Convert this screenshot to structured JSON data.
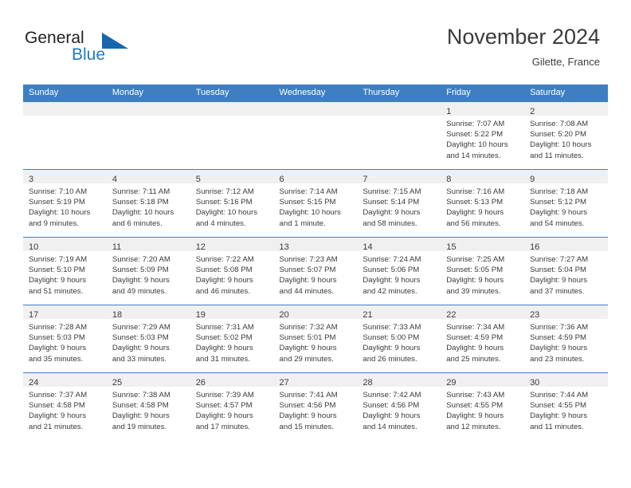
{
  "brand": {
    "name_part1": "General",
    "name_part2": "Blue",
    "logo_icon": "triangle-flag-icon",
    "accent_color": "#1667ad"
  },
  "header": {
    "title": "November 2024",
    "location": "Gilette, France"
  },
  "theme": {
    "header_blue": "#3d7fc1",
    "daynum_band": "#f0f0f0",
    "text": "#3b3b3b"
  },
  "calendar": {
    "weekday_headers": [
      "Sunday",
      "Monday",
      "Tuesday",
      "Wednesday",
      "Thursday",
      "Friday",
      "Saturday"
    ],
    "weeks": [
      [
        {
          "empty": true,
          "day": "",
          "sunrise": "",
          "sunset": "",
          "daylight_line1": "",
          "daylight_line2": ""
        },
        {
          "empty": true,
          "day": "",
          "sunrise": "",
          "sunset": "",
          "daylight_line1": "",
          "daylight_line2": ""
        },
        {
          "empty": true,
          "day": "",
          "sunrise": "",
          "sunset": "",
          "daylight_line1": "",
          "daylight_line2": ""
        },
        {
          "empty": true,
          "day": "",
          "sunrise": "",
          "sunset": "",
          "daylight_line1": "",
          "daylight_line2": ""
        },
        {
          "empty": true,
          "day": "",
          "sunrise": "",
          "sunset": "",
          "daylight_line1": "",
          "daylight_line2": ""
        },
        {
          "empty": false,
          "day": "1",
          "sunrise": "Sunrise: 7:07 AM",
          "sunset": "Sunset: 5:22 PM",
          "daylight_line1": "Daylight: 10 hours",
          "daylight_line2": "and 14 minutes."
        },
        {
          "empty": false,
          "day": "2",
          "sunrise": "Sunrise: 7:08 AM",
          "sunset": "Sunset: 5:20 PM",
          "daylight_line1": "Daylight: 10 hours",
          "daylight_line2": "and 11 minutes."
        }
      ],
      [
        {
          "empty": false,
          "day": "3",
          "sunrise": "Sunrise: 7:10 AM",
          "sunset": "Sunset: 5:19 PM",
          "daylight_line1": "Daylight: 10 hours",
          "daylight_line2": "and 9 minutes."
        },
        {
          "empty": false,
          "day": "4",
          "sunrise": "Sunrise: 7:11 AM",
          "sunset": "Sunset: 5:18 PM",
          "daylight_line1": "Daylight: 10 hours",
          "daylight_line2": "and 6 minutes."
        },
        {
          "empty": false,
          "day": "5",
          "sunrise": "Sunrise: 7:12 AM",
          "sunset": "Sunset: 5:16 PM",
          "daylight_line1": "Daylight: 10 hours",
          "daylight_line2": "and 4 minutes."
        },
        {
          "empty": false,
          "day": "6",
          "sunrise": "Sunrise: 7:14 AM",
          "sunset": "Sunset: 5:15 PM",
          "daylight_line1": "Daylight: 10 hours",
          "daylight_line2": "and 1 minute."
        },
        {
          "empty": false,
          "day": "7",
          "sunrise": "Sunrise: 7:15 AM",
          "sunset": "Sunset: 5:14 PM",
          "daylight_line1": "Daylight: 9 hours",
          "daylight_line2": "and 58 minutes."
        },
        {
          "empty": false,
          "day": "8",
          "sunrise": "Sunrise: 7:16 AM",
          "sunset": "Sunset: 5:13 PM",
          "daylight_line1": "Daylight: 9 hours",
          "daylight_line2": "and 56 minutes."
        },
        {
          "empty": false,
          "day": "9",
          "sunrise": "Sunrise: 7:18 AM",
          "sunset": "Sunset: 5:12 PM",
          "daylight_line1": "Daylight: 9 hours",
          "daylight_line2": "and 54 minutes."
        }
      ],
      [
        {
          "empty": false,
          "day": "10",
          "sunrise": "Sunrise: 7:19 AM",
          "sunset": "Sunset: 5:10 PM",
          "daylight_line1": "Daylight: 9 hours",
          "daylight_line2": "and 51 minutes."
        },
        {
          "empty": false,
          "day": "11",
          "sunrise": "Sunrise: 7:20 AM",
          "sunset": "Sunset: 5:09 PM",
          "daylight_line1": "Daylight: 9 hours",
          "daylight_line2": "and 49 minutes."
        },
        {
          "empty": false,
          "day": "12",
          "sunrise": "Sunrise: 7:22 AM",
          "sunset": "Sunset: 5:08 PM",
          "daylight_line1": "Daylight: 9 hours",
          "daylight_line2": "and 46 minutes."
        },
        {
          "empty": false,
          "day": "13",
          "sunrise": "Sunrise: 7:23 AM",
          "sunset": "Sunset: 5:07 PM",
          "daylight_line1": "Daylight: 9 hours",
          "daylight_line2": "and 44 minutes."
        },
        {
          "empty": false,
          "day": "14",
          "sunrise": "Sunrise: 7:24 AM",
          "sunset": "Sunset: 5:06 PM",
          "daylight_line1": "Daylight: 9 hours",
          "daylight_line2": "and 42 minutes."
        },
        {
          "empty": false,
          "day": "15",
          "sunrise": "Sunrise: 7:25 AM",
          "sunset": "Sunset: 5:05 PM",
          "daylight_line1": "Daylight: 9 hours",
          "daylight_line2": "and 39 minutes."
        },
        {
          "empty": false,
          "day": "16",
          "sunrise": "Sunrise: 7:27 AM",
          "sunset": "Sunset: 5:04 PM",
          "daylight_line1": "Daylight: 9 hours",
          "daylight_line2": "and 37 minutes."
        }
      ],
      [
        {
          "empty": false,
          "day": "17",
          "sunrise": "Sunrise: 7:28 AM",
          "sunset": "Sunset: 5:03 PM",
          "daylight_line1": "Daylight: 9 hours",
          "daylight_line2": "and 35 minutes."
        },
        {
          "empty": false,
          "day": "18",
          "sunrise": "Sunrise: 7:29 AM",
          "sunset": "Sunset: 5:03 PM",
          "daylight_line1": "Daylight: 9 hours",
          "daylight_line2": "and 33 minutes."
        },
        {
          "empty": false,
          "day": "19",
          "sunrise": "Sunrise: 7:31 AM",
          "sunset": "Sunset: 5:02 PM",
          "daylight_line1": "Daylight: 9 hours",
          "daylight_line2": "and 31 minutes."
        },
        {
          "empty": false,
          "day": "20",
          "sunrise": "Sunrise: 7:32 AM",
          "sunset": "Sunset: 5:01 PM",
          "daylight_line1": "Daylight: 9 hours",
          "daylight_line2": "and 29 minutes."
        },
        {
          "empty": false,
          "day": "21",
          "sunrise": "Sunrise: 7:33 AM",
          "sunset": "Sunset: 5:00 PM",
          "daylight_line1": "Daylight: 9 hours",
          "daylight_line2": "and 26 minutes."
        },
        {
          "empty": false,
          "day": "22",
          "sunrise": "Sunrise: 7:34 AM",
          "sunset": "Sunset: 4:59 PM",
          "daylight_line1": "Daylight: 9 hours",
          "daylight_line2": "and 25 minutes."
        },
        {
          "empty": false,
          "day": "23",
          "sunrise": "Sunrise: 7:36 AM",
          "sunset": "Sunset: 4:59 PM",
          "daylight_line1": "Daylight: 9 hours",
          "daylight_line2": "and 23 minutes."
        }
      ],
      [
        {
          "empty": false,
          "day": "24",
          "sunrise": "Sunrise: 7:37 AM",
          "sunset": "Sunset: 4:58 PM",
          "daylight_line1": "Daylight: 9 hours",
          "daylight_line2": "and 21 minutes."
        },
        {
          "empty": false,
          "day": "25",
          "sunrise": "Sunrise: 7:38 AM",
          "sunset": "Sunset: 4:58 PM",
          "daylight_line1": "Daylight: 9 hours",
          "daylight_line2": "and 19 minutes."
        },
        {
          "empty": false,
          "day": "26",
          "sunrise": "Sunrise: 7:39 AM",
          "sunset": "Sunset: 4:57 PM",
          "daylight_line1": "Daylight: 9 hours",
          "daylight_line2": "and 17 minutes."
        },
        {
          "empty": false,
          "day": "27",
          "sunrise": "Sunrise: 7:41 AM",
          "sunset": "Sunset: 4:56 PM",
          "daylight_line1": "Daylight: 9 hours",
          "daylight_line2": "and 15 minutes."
        },
        {
          "empty": false,
          "day": "28",
          "sunrise": "Sunrise: 7:42 AM",
          "sunset": "Sunset: 4:56 PM",
          "daylight_line1": "Daylight: 9 hours",
          "daylight_line2": "and 14 minutes."
        },
        {
          "empty": false,
          "day": "29",
          "sunrise": "Sunrise: 7:43 AM",
          "sunset": "Sunset: 4:55 PM",
          "daylight_line1": "Daylight: 9 hours",
          "daylight_line2": "and 12 minutes."
        },
        {
          "empty": false,
          "day": "30",
          "sunrise": "Sunrise: 7:44 AM",
          "sunset": "Sunset: 4:55 PM",
          "daylight_line1": "Daylight: 9 hours",
          "daylight_line2": "and 11 minutes."
        }
      ]
    ]
  }
}
